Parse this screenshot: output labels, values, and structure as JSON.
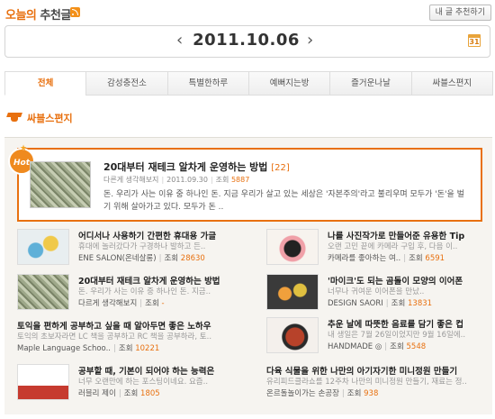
{
  "header": {
    "title_part1": "오늘의",
    "title_part2": "추천글",
    "recommend_button": "내 글 추천하기"
  },
  "date_nav": {
    "prev": "‹",
    "date": "2011.10.06",
    "next": "›",
    "calendar_day": "31"
  },
  "tabs": [
    {
      "label": "전체",
      "active": true
    },
    {
      "label": "감성충전소"
    },
    {
      "label": "특별한하루"
    },
    {
      "label": "예뻐지는방"
    },
    {
      "label": "즐거운나날"
    },
    {
      "label": "싸블스편지"
    }
  ],
  "section": {
    "title": "싸블스편지"
  },
  "featured": {
    "badge": "Hot",
    "title": "20대부터 재테크 알차게 운영하는 방법",
    "count": "[22]",
    "author": "다른게 생각해보지",
    "date": "2011.09.30",
    "hits_label": "조회",
    "hits": "5887",
    "excerpt": "돈. 우리가 사는 이유 중 하나인 돈. 지금 우리가 살고 있는 세상은 '자본주의'라고 불리우며 모두가 '돈'을 벌기 위해 살아가고 있다. 모두가 돈 .."
  },
  "items": [
    {
      "title": "어디서나 사용하기 간편한 휴대용 가글",
      "desc": "휴대에 놀러갔다가 구경하나 발하고 든..",
      "author": "ENE SALON(온네살롱)",
      "hits_label": "조회",
      "hits": "28630"
    },
    {
      "title": "나를 사진작가로 만들어준 유용한 Tip",
      "desc": "오랜 고민 끝에 카메라 구입 후, 다음 이..",
      "author": "카메라를 좋아하는 여..",
      "hits_label": "조회",
      "hits": "6591"
    },
    {
      "title": "20대부터 재테크 알차게 운영하는 방법",
      "desc": "돈. 우리가 사는 이유 중 하나인 돈. 지금..",
      "author": "다르게 생각해보지",
      "hits_label": "조회",
      "hits": "-"
    },
    {
      "title": "'마이크'도 되는 곰돌이 모양의 이어폰",
      "desc": "너무나 귀여운 이어폰을 만났..",
      "author": "DESIGN SAORI",
      "hits_label": "조회",
      "hits": "13831"
    },
    {
      "title": "토익을 편하게 공부하고 싶을 때 알아두면 좋은 노하우",
      "desc": "토익의 초보자라면 LC 책을 공부하고 RC 책을 공부하라, 토..",
      "author": "Maple Language Schoo..",
      "hits_label": "조회",
      "hits": "10221"
    },
    {
      "title": "추운 날에 따뜻한 음료를 담기 좋은 컵",
      "desc": "내 생일은 7월 26일이었지만 9월 16일에..",
      "author": "HANDMADE ◎",
      "hits_label": "조회",
      "hits": "5548"
    },
    {
      "title": "공부할 때, 기본이 되어야 하는 능력은",
      "desc": "너무 오랜만에 하는 포스팅이네요. 요즘..",
      "author": "러블리 제이",
      "hits_label": "조회",
      "hits": "1805"
    },
    {
      "title": "다육 식물을 위한 나만의 아기자기한 미니정원 만들기",
      "desc": "유리피드클라쇼를 12주차 나만의 미니정원 만들기, 재료는 정..",
      "author": "온르돌놀이가는 손공장",
      "hits_label": "조회",
      "hits": "938"
    }
  ]
}
